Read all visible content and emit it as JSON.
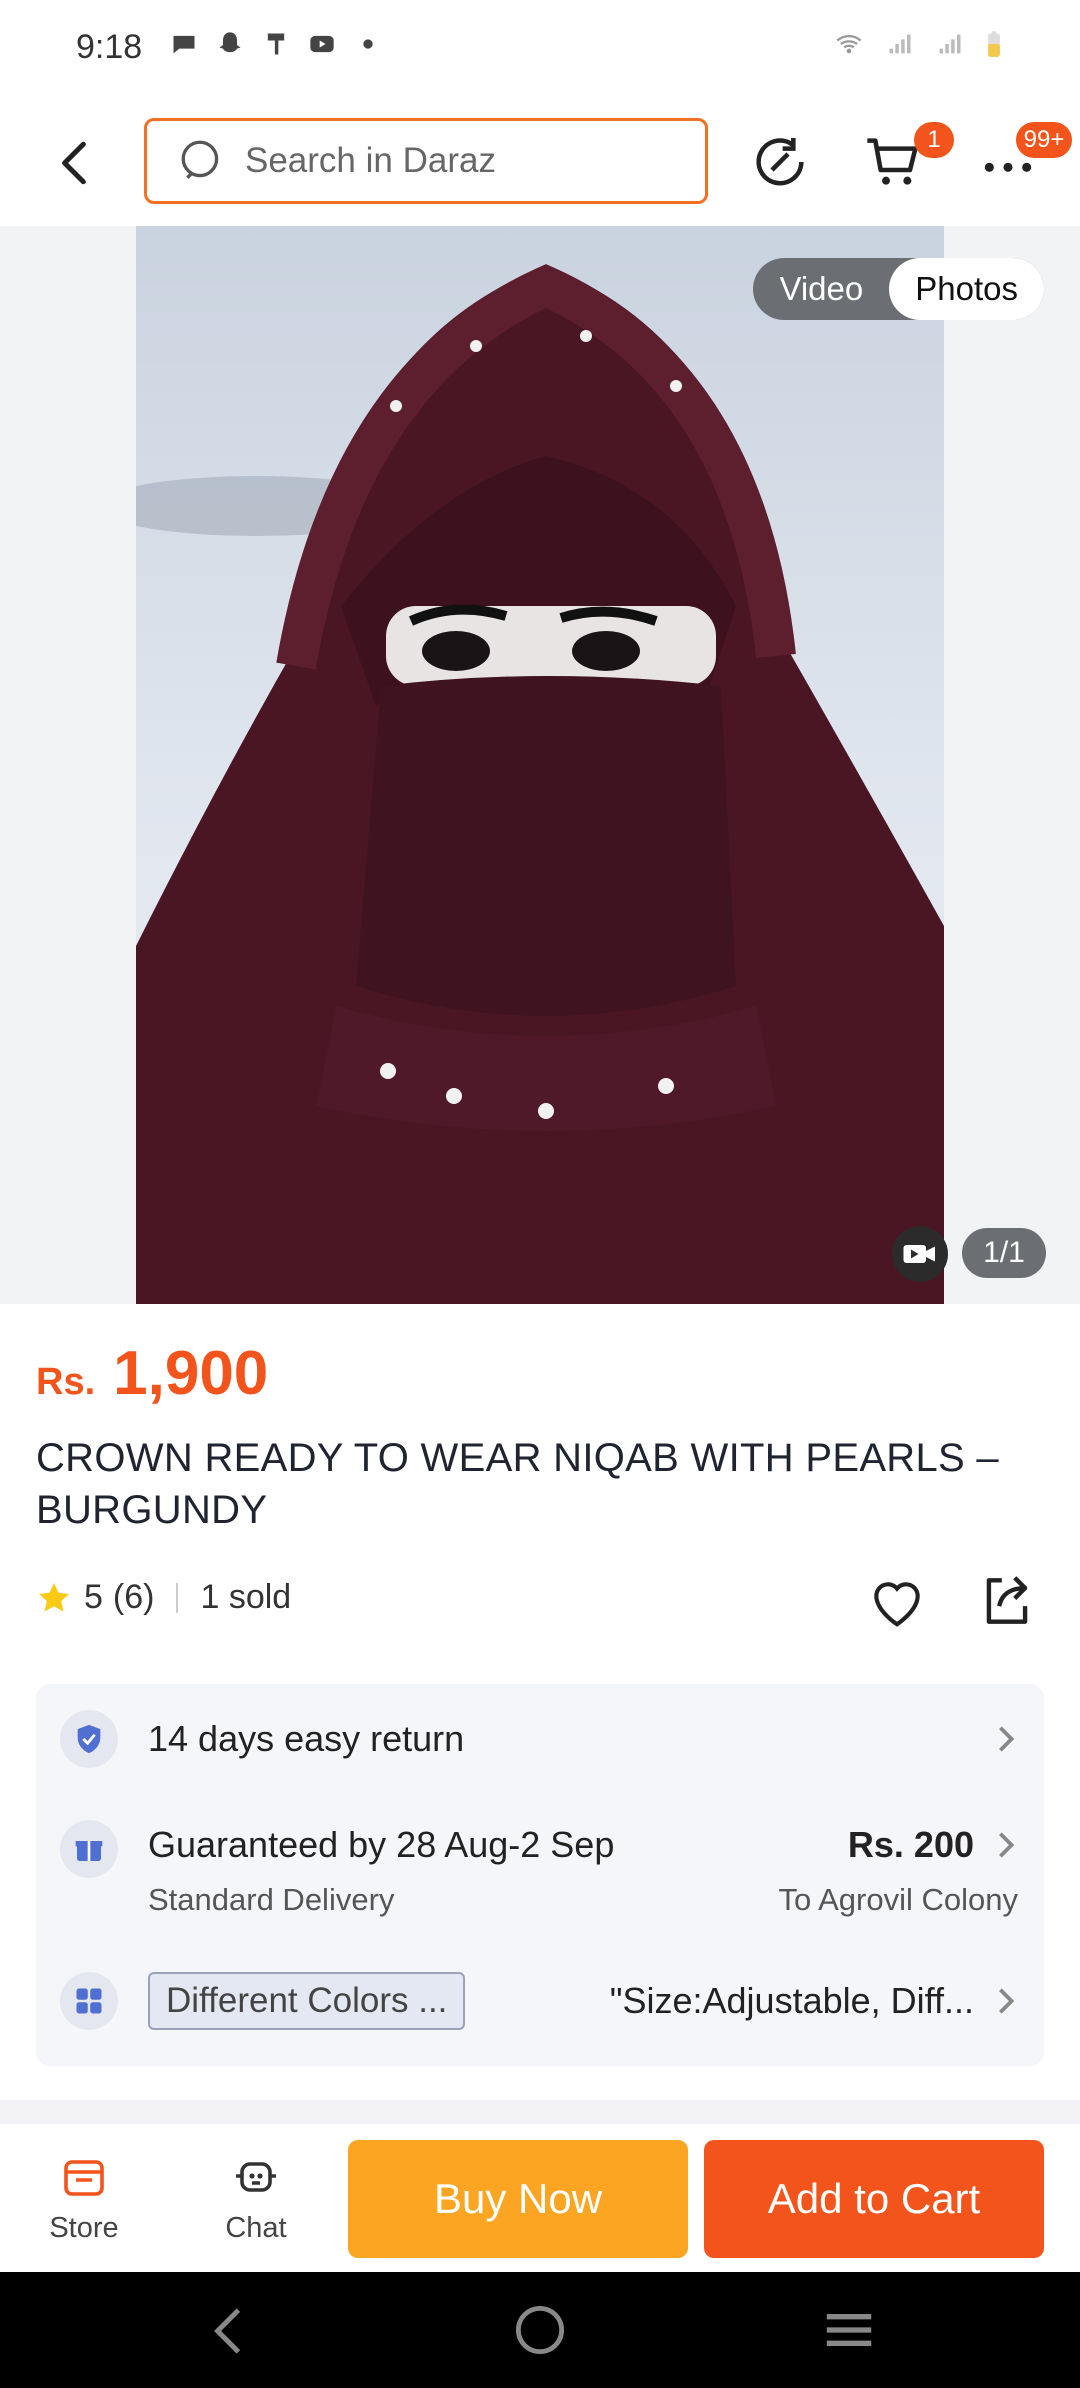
{
  "status_bar": {
    "time": "9:18"
  },
  "header": {
    "search_placeholder": "Search in Daraz",
    "cart_badge": "1",
    "more_badge": "99+"
  },
  "gallery": {
    "tab_video": "Video",
    "tab_photos": "Photos",
    "active_tab": "Photos",
    "pager": "1/1"
  },
  "product": {
    "currency": "Rs.",
    "price": "1,900",
    "title": "CROWN READY TO WEAR NIQAB WITH PEARLS – BURGUNDY",
    "rating": "5",
    "rating_count": "(6)",
    "sold": "1 sold"
  },
  "services": {
    "return": "14 days easy return",
    "delivery_main": "Guaranteed by 28 Aug-2 Sep",
    "delivery_sub": "Standard Delivery",
    "delivery_fee": "Rs. 200",
    "delivery_to": "To Agrovil Colony",
    "variant_tag": "Different Colors ...",
    "variant_text": "\"Size:Adjustable, Diff..."
  },
  "bottom_bar": {
    "store_label": "Store",
    "chat_label": "Chat",
    "buy_now": "Buy Now",
    "add_to_cart": "Add to Cart"
  },
  "colors": {
    "brand_orange": "#f2541b",
    "buy_now_yellow": "#fca522",
    "search_border": "#f36f21"
  }
}
